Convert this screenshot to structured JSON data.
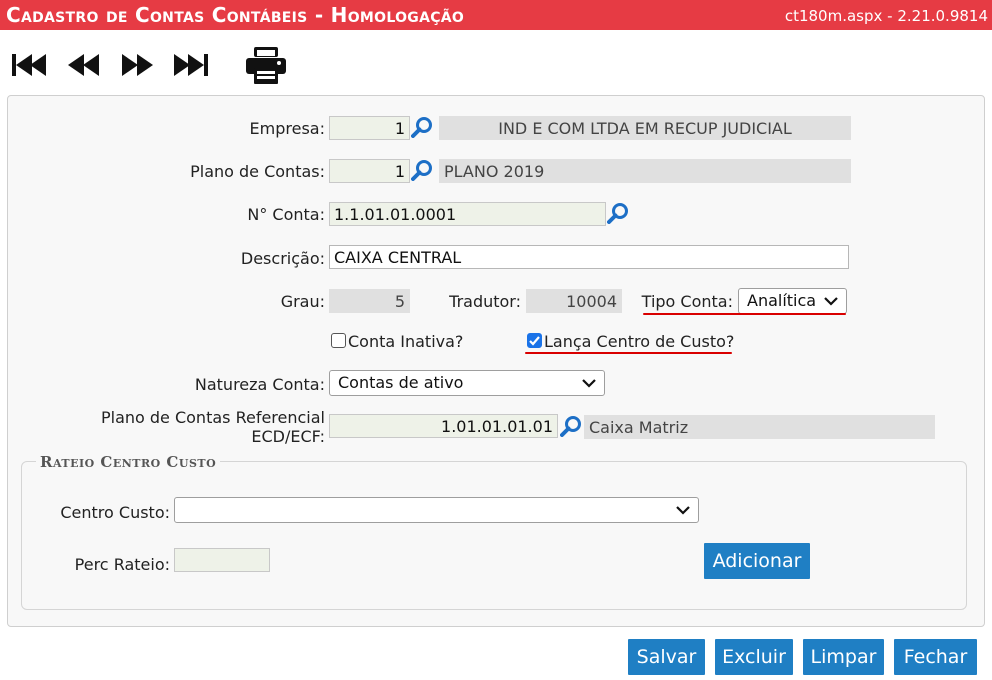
{
  "header": {
    "title": "Cadastro de Contas Contábeis  - Homologação",
    "version": "ct180m.aspx - 2.21.0.9814",
    "bg_color": "#e63b44"
  },
  "toolbar": {
    "first_icon": "skip-first-icon",
    "prev_icon": "previous-icon",
    "next_icon": "next-icon",
    "last_icon": "skip-last-icon",
    "print_icon": "printer-icon"
  },
  "form": {
    "empresa": {
      "label": "Empresa:",
      "code": "1",
      "name": "IND E COM LTDA EM RECUP JUDICIAL"
    },
    "plano": {
      "label": "Plano de Contas:",
      "code": "1",
      "name": "PLANO 2019"
    },
    "conta": {
      "label": "N° Conta:",
      "value": "1.1.01.01.0001"
    },
    "descricao": {
      "label": "Descrição:",
      "value": "CAIXA CENTRAL"
    },
    "grau": {
      "label": "Grau:",
      "value": "5"
    },
    "tradutor": {
      "label": "Tradutor:",
      "value": "10004"
    },
    "tipo_conta": {
      "label": "Tipo Conta:",
      "value": "Analítica"
    },
    "conta_inativa": {
      "label": "Conta Inativa?",
      "checked": false
    },
    "lanca_cc": {
      "label": "Lança Centro de Custo?",
      "checked": true
    },
    "natureza": {
      "label": "Natureza Conta:",
      "value": "Contas de ativo"
    },
    "plano_ref": {
      "label_line1": "Plano de Contas Referencial",
      "label_line2": "ECD/ECF:",
      "code": "1.01.01.01.01",
      "name": "Caixa Matriz"
    }
  },
  "rateio": {
    "legend": "Rateio Centro Custo",
    "centro_custo": {
      "label": "Centro Custo:",
      "value": ""
    },
    "perc": {
      "label": "Perc Rateio:",
      "value": ""
    },
    "add_button": "Adicionar"
  },
  "actions": {
    "save": "Salvar",
    "delete": "Excluir",
    "clear": "Limpar",
    "close": "Fechar",
    "button_color": "#1f7fc4"
  }
}
